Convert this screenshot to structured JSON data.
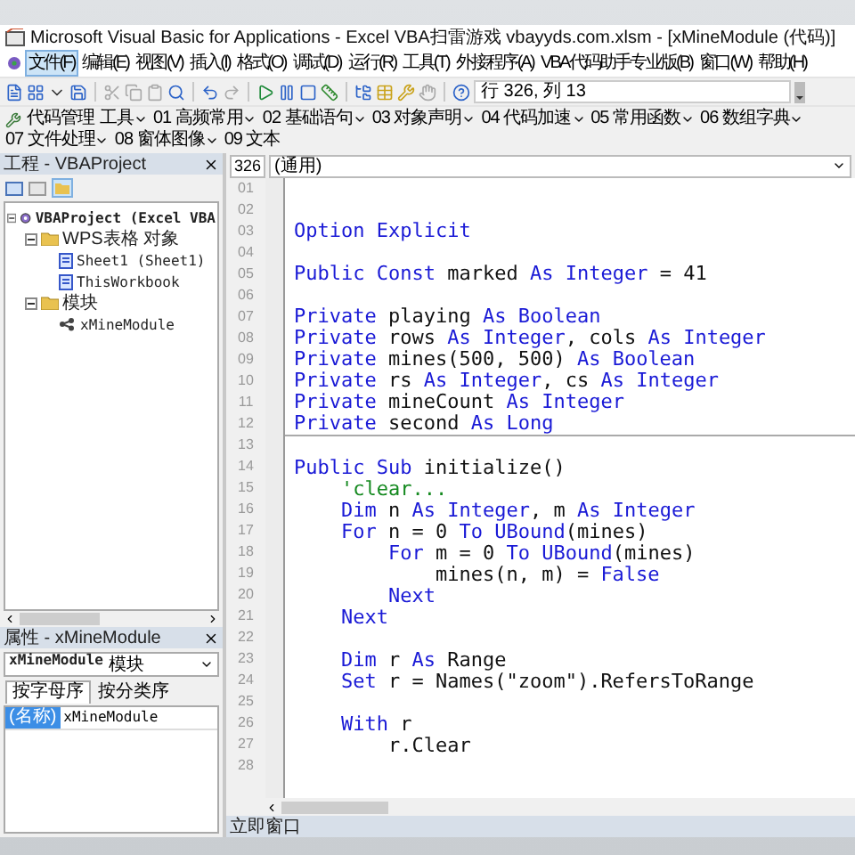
{
  "window": {
    "title": "Microsoft Visual Basic for Applications - Excel VBA扫雷游戏 vbayyds.com.xlsm - [xMineModule (代码)]"
  },
  "menu": [
    {
      "label": "文件(F)",
      "selected": true
    },
    {
      "label": "编辑(E)",
      "selected": false
    },
    {
      "label": "视图(V)",
      "selected": false
    },
    {
      "label": "插入(I)",
      "selected": false
    },
    {
      "label": "格式(O)",
      "selected": false
    },
    {
      "label": "调试(D)",
      "selected": false
    },
    {
      "label": "运行(R)",
      "selected": false
    },
    {
      "label": "工具(T)",
      "selected": false
    },
    {
      "label": "外接程序(A)",
      "selected": false
    },
    {
      "label": "VBA代码助手专业版(B)",
      "selected": false
    },
    {
      "label": "窗口(W)",
      "selected": false
    },
    {
      "label": "帮助(H)",
      "selected": false
    }
  ],
  "toolbar": {
    "position": "行 326, 列 13"
  },
  "addin_toolbar": [
    {
      "label": "代码管理",
      "dropdown": false
    },
    {
      "label": "工具",
      "dropdown": true
    },
    {
      "label": "01 高频常用",
      "dropdown": true
    },
    {
      "label": "02 基础语句",
      "dropdown": true
    },
    {
      "label": "03 对象声明",
      "dropdown": true
    },
    {
      "label": "04 代码加速",
      "dropdown": true
    },
    {
      "label": "05 常用函数",
      "dropdown": true
    },
    {
      "label": "06 数组字典",
      "dropdown": true
    },
    {
      "label": "07 文件处理",
      "dropdown": true
    },
    {
      "label": "08 窗体图像",
      "dropdown": true
    },
    {
      "label": "09 文本",
      "dropdown": false
    }
  ],
  "project": {
    "title": "工程 - VBAProject",
    "tree": [
      {
        "label": "VBAProject (Excel VBA",
        "kind": "project",
        "expanded": true,
        "children": [
          {
            "label": "WPS表格 对象",
            "kind": "folder",
            "expanded": true,
            "children": [
              {
                "label": "Sheet1 (Sheet1)",
                "kind": "sheet"
              },
              {
                "label": "ThisWorkbook",
                "kind": "sheet"
              }
            ]
          },
          {
            "label": "模块",
            "kind": "folder",
            "expanded": true,
            "children": [
              {
                "label": "xMineModule",
                "kind": "module"
              }
            ]
          }
        ]
      }
    ]
  },
  "properties": {
    "title": "属性 - xMineModule",
    "object": "xMineModule",
    "object_type": "模块",
    "tabs": [
      {
        "label": "按字母序",
        "selected": true
      },
      {
        "label": "按分类序",
        "selected": false
      }
    ],
    "rows": [
      {
        "name": "(名称)",
        "value": "xMineModule",
        "selected": true
      }
    ]
  },
  "code": {
    "line_box": "326",
    "procedure": "(通用)",
    "procedures": [
      {
        "lines": [
          {
            "no": "01"
          },
          {
            "no": "02"
          },
          {
            "no": "03",
            "tokens": [
              {
                "kind": "keyword",
                "text": "Option Explicit"
              }
            ]
          },
          {
            "no": "04"
          },
          {
            "no": "05",
            "tokens": [
              {
                "kind": "keyword",
                "text": "Public Const"
              },
              {
                "kind": "plain",
                "text": " marked "
              },
              {
                "kind": "keyword",
                "text": "As Integer"
              },
              {
                "kind": "plain",
                "text": " = 41"
              }
            ]
          },
          {
            "no": "06"
          },
          {
            "no": "07",
            "tokens": [
              {
                "kind": "keyword",
                "text": "Private"
              },
              {
                "kind": "plain",
                "text": " playing "
              },
              {
                "kind": "keyword",
                "text": "As Boolean"
              }
            ]
          },
          {
            "no": "08",
            "tokens": [
              {
                "kind": "keyword",
                "text": "Private"
              },
              {
                "kind": "plain",
                "text": " rows "
              },
              {
                "kind": "keyword",
                "text": "As Integer"
              },
              {
                "kind": "plain",
                "text": ", cols "
              },
              {
                "kind": "keyword",
                "text": "As Integer"
              }
            ]
          },
          {
            "no": "09",
            "tokens": [
              {
                "kind": "keyword",
                "text": "Private"
              },
              {
                "kind": "plain",
                "text": " mines(500, 500) "
              },
              {
                "kind": "keyword",
                "text": "As Boolean"
              }
            ]
          },
          {
            "no": "10",
            "tokens": [
              {
                "kind": "keyword",
                "text": "Private"
              },
              {
                "kind": "plain",
                "text": " rs "
              },
              {
                "kind": "keyword",
                "text": "As Integer"
              },
              {
                "kind": "plain",
                "text": ", cs "
              },
              {
                "kind": "keyword",
                "text": "As Integer"
              }
            ]
          },
          {
            "no": "11",
            "tokens": [
              {
                "kind": "keyword",
                "text": "Private"
              },
              {
                "kind": "plain",
                "text": " mineCount "
              },
              {
                "kind": "keyword",
                "text": "As Integer"
              }
            ]
          },
          {
            "no": "12",
            "tokens": [
              {
                "kind": "keyword",
                "text": "Private"
              },
              {
                "kind": "plain",
                "text": " second "
              },
              {
                "kind": "keyword",
                "text": "As Long"
              }
            ]
          }
        ]
      },
      {
        "lines": [
          {
            "no": "13"
          },
          {
            "no": "14",
            "tokens": [
              {
                "kind": "keyword",
                "text": "Public Sub"
              },
              {
                "kind": "plain",
                "text": " initialize()"
              }
            ]
          },
          {
            "no": "15",
            "tokens": [
              {
                "kind": "comment",
                "text": "    'clear..."
              }
            ]
          },
          {
            "no": "16",
            "tokens": [
              {
                "kind": "keyword",
                "text": "    Dim"
              },
              {
                "kind": "plain",
                "text": " n "
              },
              {
                "kind": "keyword",
                "text": "As Integer"
              },
              {
                "kind": "plain",
                "text": ", m "
              },
              {
                "kind": "keyword",
                "text": "As Integer"
              }
            ]
          },
          {
            "no": "17",
            "tokens": [
              {
                "kind": "keyword",
                "text": "    For"
              },
              {
                "kind": "plain",
                "text": " n = 0 "
              },
              {
                "kind": "keyword",
                "text": "To UBound"
              },
              {
                "kind": "plain",
                "text": "(mines)"
              }
            ]
          },
          {
            "no": "18",
            "tokens": [
              {
                "kind": "keyword",
                "text": "        For"
              },
              {
                "kind": "plain",
                "text": " m = 0 "
              },
              {
                "kind": "keyword",
                "text": "To UBound"
              },
              {
                "kind": "plain",
                "text": "(mines)"
              }
            ]
          },
          {
            "no": "19",
            "tokens": [
              {
                "kind": "plain",
                "text": "            mines(n, m) = "
              },
              {
                "kind": "keyword",
                "text": "False"
              }
            ]
          },
          {
            "no": "20",
            "tokens": [
              {
                "kind": "keyword",
                "text": "        Next"
              }
            ]
          },
          {
            "no": "21",
            "tokens": [
              {
                "kind": "keyword",
                "text": "    Next"
              }
            ]
          },
          {
            "no": "22"
          },
          {
            "no": "23",
            "tokens": [
              {
                "kind": "keyword",
                "text": "    Dim"
              },
              {
                "kind": "plain",
                "text": " r "
              },
              {
                "kind": "keyword",
                "text": "As"
              },
              {
                "kind": "plain",
                "text": " Range"
              }
            ]
          },
          {
            "no": "24",
            "tokens": [
              {
                "kind": "keyword",
                "text": "    Set"
              },
              {
                "kind": "plain",
                "text": " r = Names(\"zoom\").RefersToRange"
              }
            ]
          },
          {
            "no": "25"
          },
          {
            "no": "26",
            "tokens": [
              {
                "kind": "keyword",
                "text": "    With"
              },
              {
                "kind": "plain",
                "text": " r"
              }
            ]
          },
          {
            "no": "27",
            "tokens": [
              {
                "kind": "plain",
                "text": "        r.Clear"
              }
            ]
          },
          {
            "no": "28"
          }
        ]
      }
    ]
  },
  "immediate": {
    "title": "立即窗口"
  }
}
